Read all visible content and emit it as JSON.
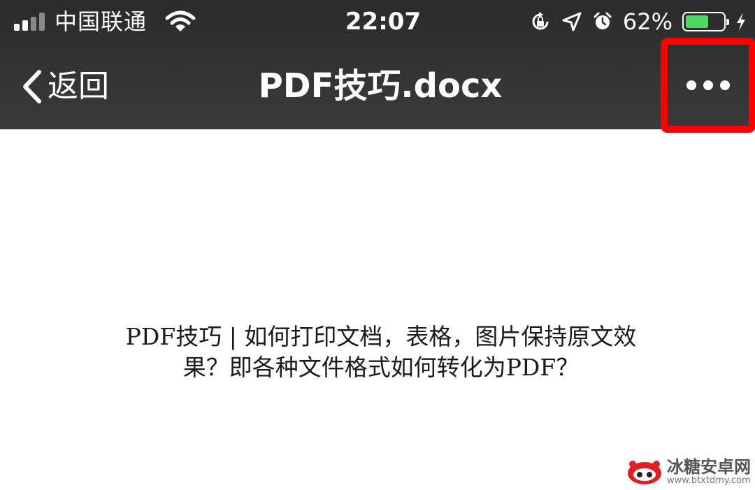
{
  "status_bar": {
    "carrier": "中国联通",
    "time": "22:07",
    "battery_percent_label": "62%",
    "battery_level": 0.62,
    "icons": [
      "signal-icon",
      "wifi-icon",
      "rotation-lock-icon",
      "location-arrow-icon",
      "alarm-icon",
      "battery-icon",
      "charging-bolt-icon"
    ]
  },
  "nav_bar": {
    "back_label": "返回",
    "title": "PDF技巧.docx",
    "more_icon": "more-dots-icon",
    "highlight_color": "#ff0000"
  },
  "document": {
    "lines": [
      "PDF技巧 | 如何打印文档，表格，图片保持原文效",
      "果？即各种文件格式如何转化为PDF？"
    ]
  },
  "watermark": {
    "name": "冰糖安卓网",
    "url": "www.btxtdmy.com"
  },
  "colors": {
    "nav_background": "#333333",
    "battery_fill": "#4cd964",
    "page_background": "#ffffff"
  }
}
